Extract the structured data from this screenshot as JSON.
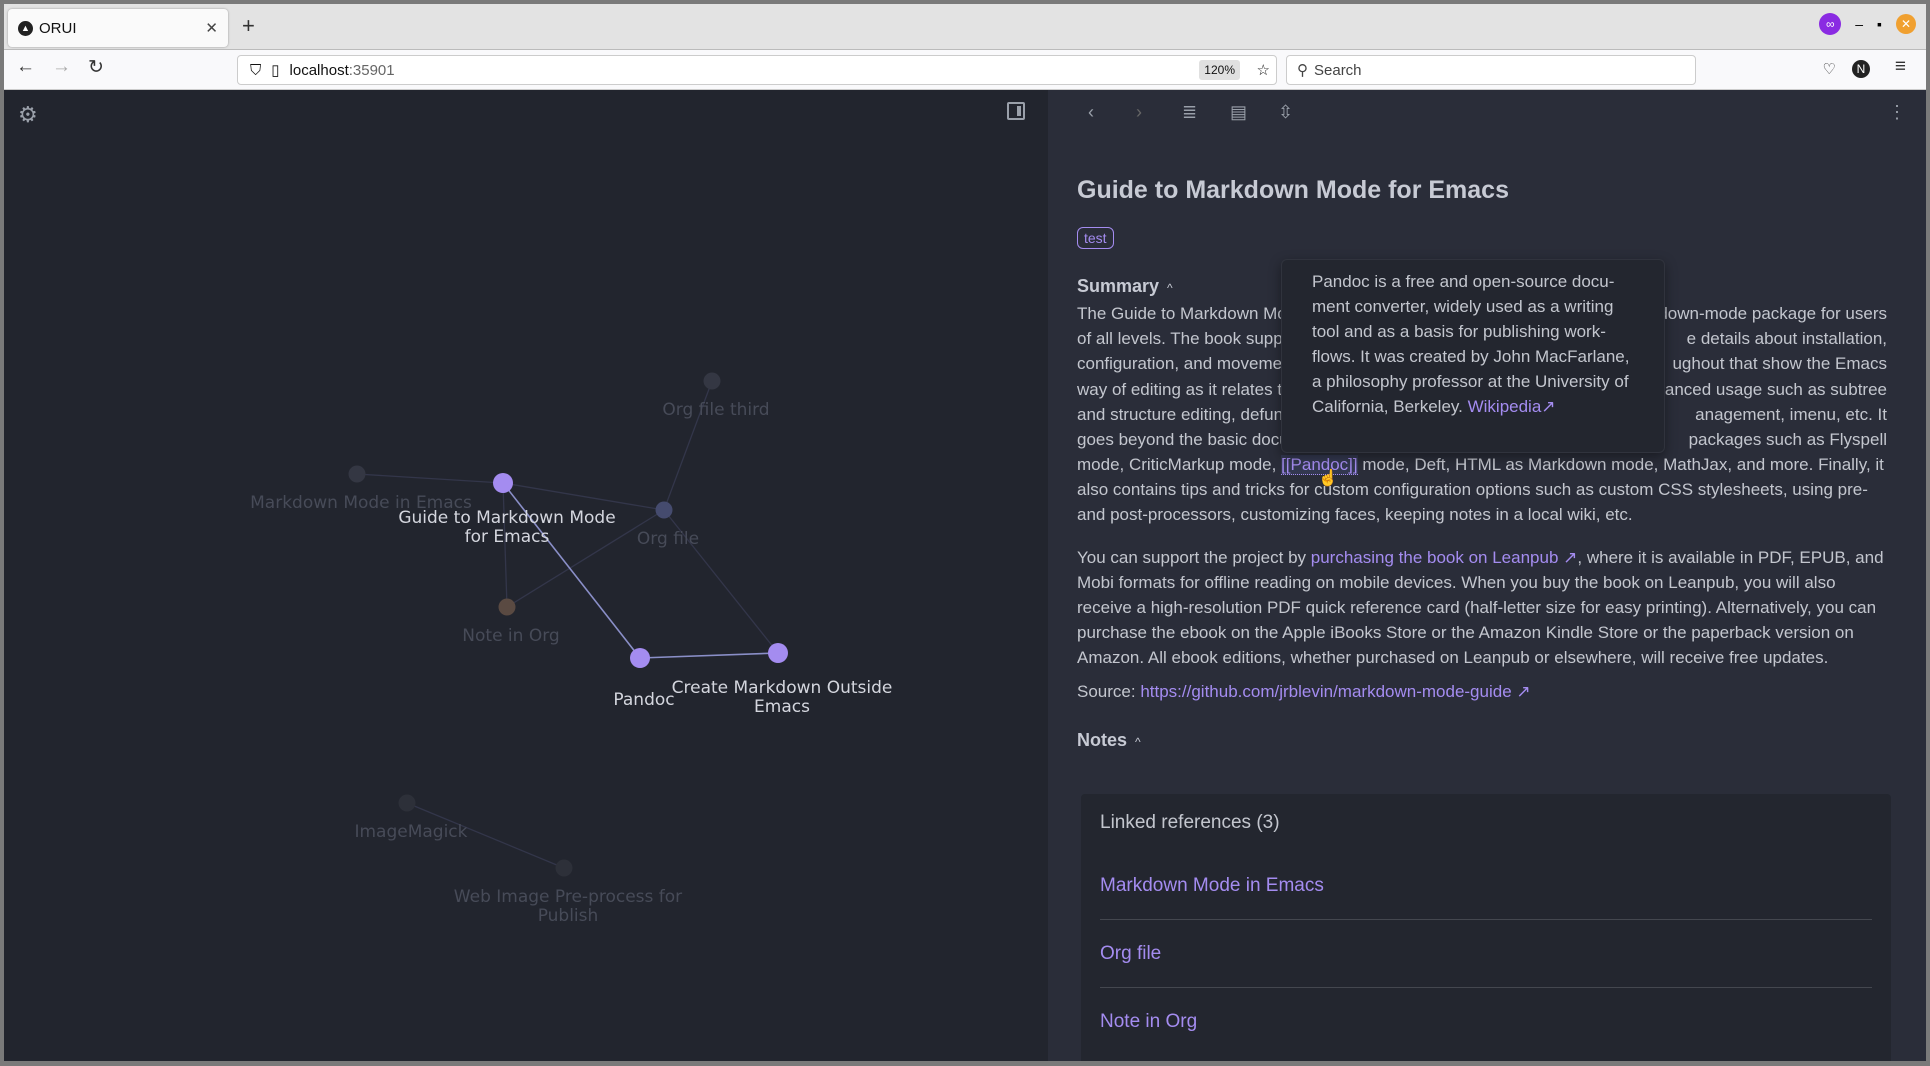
{
  "browser": {
    "tab_title": "ORUI",
    "url_host": "localhost",
    "url_port": ":35901",
    "zoom": "120%",
    "search_placeholder": "Search"
  },
  "colors": {
    "accent": "#a48cf0",
    "panel_bg": "#2a2d39",
    "graph_bg": "#22252e"
  },
  "graph": {
    "nodes": [
      {
        "id": "org-file-third",
        "label": [
          "Org file third"
        ],
        "active": false,
        "color": "#343743"
      },
      {
        "id": "markdown-mode-in-emacs",
        "label": [
          "Markdown Mode in Emacs"
        ],
        "active": false,
        "color": "#343743"
      },
      {
        "id": "guide",
        "label": [
          "Guide to Markdown Mode",
          "for Emacs"
        ],
        "active": true,
        "color": "#a48cf0"
      },
      {
        "id": "org-file",
        "label": [
          "Org file"
        ],
        "active": false,
        "color": "#454b6e"
      },
      {
        "id": "note-in-org",
        "label": [
          "Note in Org"
        ],
        "active": false,
        "color": "#5a4a42"
      },
      {
        "id": "pandoc",
        "label": [
          "Pandoc"
        ],
        "active": true,
        "color": "#a48cf0"
      },
      {
        "id": "create-markdown",
        "label": [
          "Create Markdown Outside",
          "Emacs"
        ],
        "active": true,
        "color": "#a48cf0"
      },
      {
        "id": "imagemagick",
        "label": [
          "ImageMagick"
        ],
        "active": false,
        "color": "#2d3039"
      },
      {
        "id": "web-image",
        "label": [
          "Web Image Pre-process for",
          "Publish"
        ],
        "active": false,
        "color": "#2d3039"
      }
    ]
  },
  "note": {
    "title": "Guide to Markdown Mode for Emacs",
    "tag": "test",
    "summary_heading": "Summary",
    "summary_lines": [
      {
        "l": "The Guide to Markdown Mo",
        "r": "down-mode package for users"
      },
      {
        "l": "of all levels. The book supp",
        "r": "e details about installation,"
      },
      {
        "l": "configuration, and moveme",
        "r": "ughout that show the Emacs"
      },
      {
        "l": "way of editing as it relates t",
        "r": "vanced usage such as subtree"
      },
      {
        "l": "and structure editing, defun",
        "r": "anagement, imenu, etc. It"
      },
      {
        "l": "goes beyond the basic docu",
        "r": "packages such as Flyspell"
      }
    ],
    "line7_a": "mode, CriticMarkup mode, ",
    "line7_link": "[[Pandoc]]",
    "line7_b": " mode, Deft, HTML as Markdown mode, MathJax, and more. Finally, it",
    "line8": "also contains tips and tricks for custom configuration options such as custom CSS stylesheets, using pre-",
    "line9": "and post-processors, customizing faces, keeping notes in a local wiki, etc.",
    "p2_a": "You can support the project by ",
    "p2_link": "purchasing the book on Leanpub",
    "p2_b": ", where it is available in PDF, EPUB, and Mobi formats for offline reading on mobile devices. When you buy the book on Leanpub, you will also receive a high-resolution PDF quick reference card (half-letter size for easy printing). Alternatively, you can purchase the ebook on the Apple iBooks Store or the Amazon Kindle Store or the paperback version on Amazon. All ebook editions, whether purchased on Leanpub or elsewhere, will receive free updates.",
    "source_label": "Source: ",
    "source_link": "https://github.com/jrblevin/markdown-mode-guide",
    "notes_heading": "Notes"
  },
  "tooltip": {
    "text": "Pandoc is a free and open-source docu-ment converter, widely used as a writing tool and as a basis for publishing work-flows. It was created by John MacFarlane, a philosophy professor at the University of California, Berkeley. ",
    "link": "Wikipedia"
  },
  "linked_refs": {
    "heading": "Linked references (3)",
    "items": [
      "Markdown Mode in Emacs",
      "Org file",
      "Note in Org"
    ]
  },
  "icons": {
    "collapse": "chevron-up",
    "external": "external-link"
  }
}
